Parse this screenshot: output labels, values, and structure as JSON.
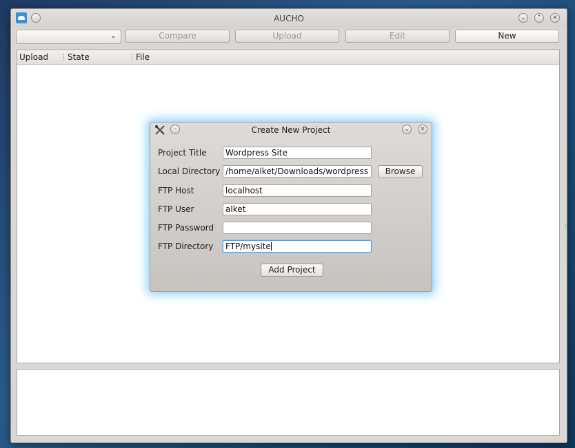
{
  "window": {
    "title": "AUCHO",
    "minimize_glyph": "⌄",
    "maximize_glyph": "⌃",
    "close_glyph": "✕"
  },
  "toolbar": {
    "project_select_value": "",
    "compare_label": "Compare",
    "upload_label": "Upload",
    "edit_label": "Edit",
    "new_label": "New"
  },
  "table": {
    "columns": [
      "Upload",
      "State",
      "File"
    ],
    "rows": []
  },
  "dialog": {
    "title": "Create New Project",
    "fields": [
      {
        "label": "Project Title",
        "value": "Wordpress Site"
      },
      {
        "label": "Local Directory",
        "value": "/home/alket/Downloads/wordpress"
      },
      {
        "label": "FTP Host",
        "value": "localhost"
      },
      {
        "label": "FTP User",
        "value": "alket"
      },
      {
        "label": "FTP Password",
        "value": ""
      },
      {
        "label": "FTP Directory",
        "value": "FTP/mysite"
      }
    ],
    "browse_label": "Browse",
    "add_project_label": "Add Project"
  },
  "icons": {
    "app": "cloud-icon",
    "dialog": "tools-icon"
  },
  "colors": {
    "accent": "#3b8fd9",
    "focus_glow": "#78c8ff"
  }
}
